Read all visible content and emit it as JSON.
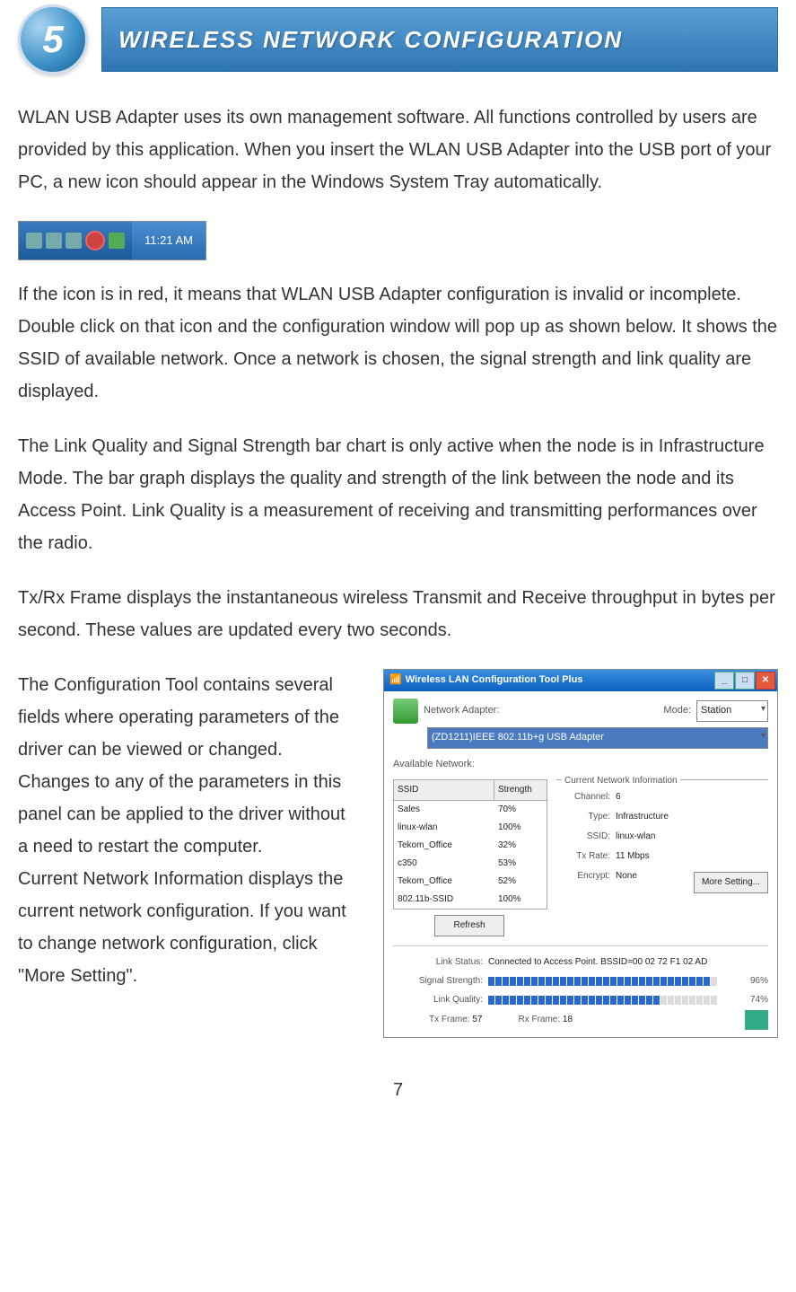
{
  "header": {
    "step": "5",
    "title": "WIRELESS NETWORK CONFIGURATION"
  },
  "paragraphs": {
    "p1": "WLAN USB Adapter uses its own management software. All functions controlled by users are provided by this application. When you insert the WLAN USB Adapter into the USB port of your PC, a new icon should appear in the Windows System Tray automatically.",
    "p2": "If the icon is in red, it means that WLAN USB Adapter configuration is invalid or incomplete. Double click on that icon and the configuration window will pop up as shown below. It shows the SSID of available network. Once a network is chosen, the signal strength and link quality are displayed.",
    "p3": "The Link Quality and Signal Strength bar chart is only active when the node is in Infrastructure Mode. The bar graph displays the quality and strength of the link between the node and its Access Point. Link Quality is a measurement of receiving and transmitting performances over the radio.",
    "p4": "Tx/Rx Frame displays the instantaneous wireless Transmit and Receive throughput in bytes per second. These values are updated every two seconds.",
    "p5a": "The Configuration Tool contains several fields where operating parameters of the driver can be viewed or changed. Changes to any of the parameters in this panel can be applied to the driver without a need to restart the computer.",
    "p5b": "Current Network Information displays the current network configuration. If you want to change network configuration, click \"More Setting\"."
  },
  "tray": {
    "time": "11:21 AM"
  },
  "dialog": {
    "title": "Wireless LAN Configuration Tool Plus",
    "network_adapter_label": "Network Adapter:",
    "mode_label": "Mode:",
    "mode_value": "Station",
    "adapter_value": "(ZD1211)IEEE 802.11b+g USB Adapter",
    "available_label": "Available Network:",
    "table_headers": {
      "ssid": "SSID",
      "strength": "Strength"
    },
    "networks": [
      {
        "ssid": "Sales",
        "strength": "70%"
      },
      {
        "ssid": "linux-wlan",
        "strength": "100%"
      },
      {
        "ssid": "Tekom_Office",
        "strength": "32%"
      },
      {
        "ssid": "c350",
        "strength": "53%"
      },
      {
        "ssid": "Tekom_Office",
        "strength": "52%"
      },
      {
        "ssid": "802.11b-SSID",
        "strength": "100%"
      }
    ],
    "refresh": "Refresh",
    "info_title": "Current Network Information",
    "info": {
      "channel_k": "Channel:",
      "channel_v": "6",
      "type_k": "Type:",
      "type_v": "Infrastructure",
      "ssid_k": "SSID:",
      "ssid_v": "linux-wlan",
      "txrate_k": "Tx Rate:",
      "txrate_v": "11 Mbps",
      "encrypt_k": "Encrypt:",
      "encrypt_v": "None"
    },
    "more_setting": "More Setting...",
    "status": {
      "link_status_k": "Link Status:",
      "link_status_v": "Connected to Access Point. BSSID=00 02 72 F1 02 AD",
      "signal_k": "Signal Strength:",
      "signal_v": "96%",
      "quality_k": "Link Quality:",
      "quality_v": "74%",
      "txframe_k": "Tx Frame:",
      "txframe_v": "57",
      "rxframe_k": "Rx Frame:",
      "rxframe_v": "18"
    }
  },
  "page_number": "7",
  "chart_data": {
    "type": "bar",
    "note": "Two horizontal progress bars shown inside the dialog screenshot",
    "series": [
      {
        "name": "Signal Strength",
        "value": 96,
        "unit": "%"
      },
      {
        "name": "Link Quality",
        "value": 74,
        "unit": "%"
      }
    ],
    "range": [
      0,
      100
    ]
  }
}
